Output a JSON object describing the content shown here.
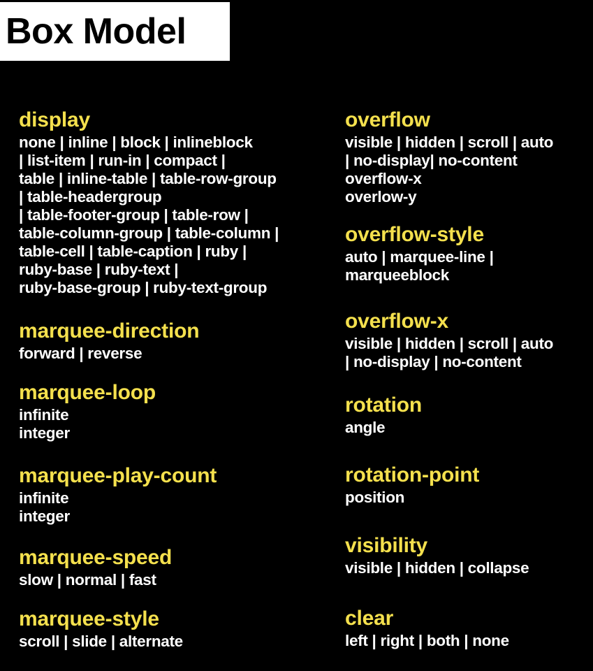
{
  "title": "Box Model",
  "colors": {
    "background": "#000000",
    "title_background": "#ffffff",
    "title_text": "#000000",
    "heading": "#f4e04d",
    "values": "#ffffff"
  },
  "left_column": [
    {
      "property": "display",
      "lines": [
        "none | inline | block | inlineblock",
        "| list-item | run-in | compact |",
        "table | inline-table | table-row-group",
        "| table-headergroup",
        "| table-footer-group | table-row |",
        "table-column-group | table-column |",
        "table-cell | table-caption | ruby |",
        "ruby-base | ruby-text |",
        "ruby-base-group | ruby-text-group"
      ]
    },
    {
      "property": "marquee-direction",
      "lines": [
        "forward | reverse"
      ]
    },
    {
      "property": "marquee-loop",
      "lines": [
        "infinite",
        "integer"
      ]
    },
    {
      "property": "marquee-play-count",
      "lines": [
        "infinite",
        "integer"
      ]
    },
    {
      "property": "marquee-speed",
      "lines": [
        "slow | normal | fast"
      ]
    },
    {
      "property": "marquee-style",
      "lines": [
        "scroll | slide | alternate"
      ]
    }
  ],
  "right_column": [
    {
      "property": "overflow",
      "lines": [
        "visible | hidden | scroll | auto",
        "| no-display| no-content",
        "overflow-x",
        "overlow-y"
      ]
    },
    {
      "property": "overflow-style",
      "lines": [
        "auto | marquee-line |",
        "marqueeblock"
      ]
    },
    {
      "property": "overflow-x",
      "lines": [
        "visible | hidden | scroll | auto",
        "| no-display | no-content"
      ]
    },
    {
      "property": "rotation",
      "lines": [
        "angle"
      ]
    },
    {
      "property": "rotation-point",
      "lines": [
        "position"
      ]
    },
    {
      "property": "visibility",
      "lines": [
        "visible | hidden | collapse"
      ]
    },
    {
      "property": "clear",
      "lines": [
        "left | right | both | none"
      ]
    }
  ]
}
